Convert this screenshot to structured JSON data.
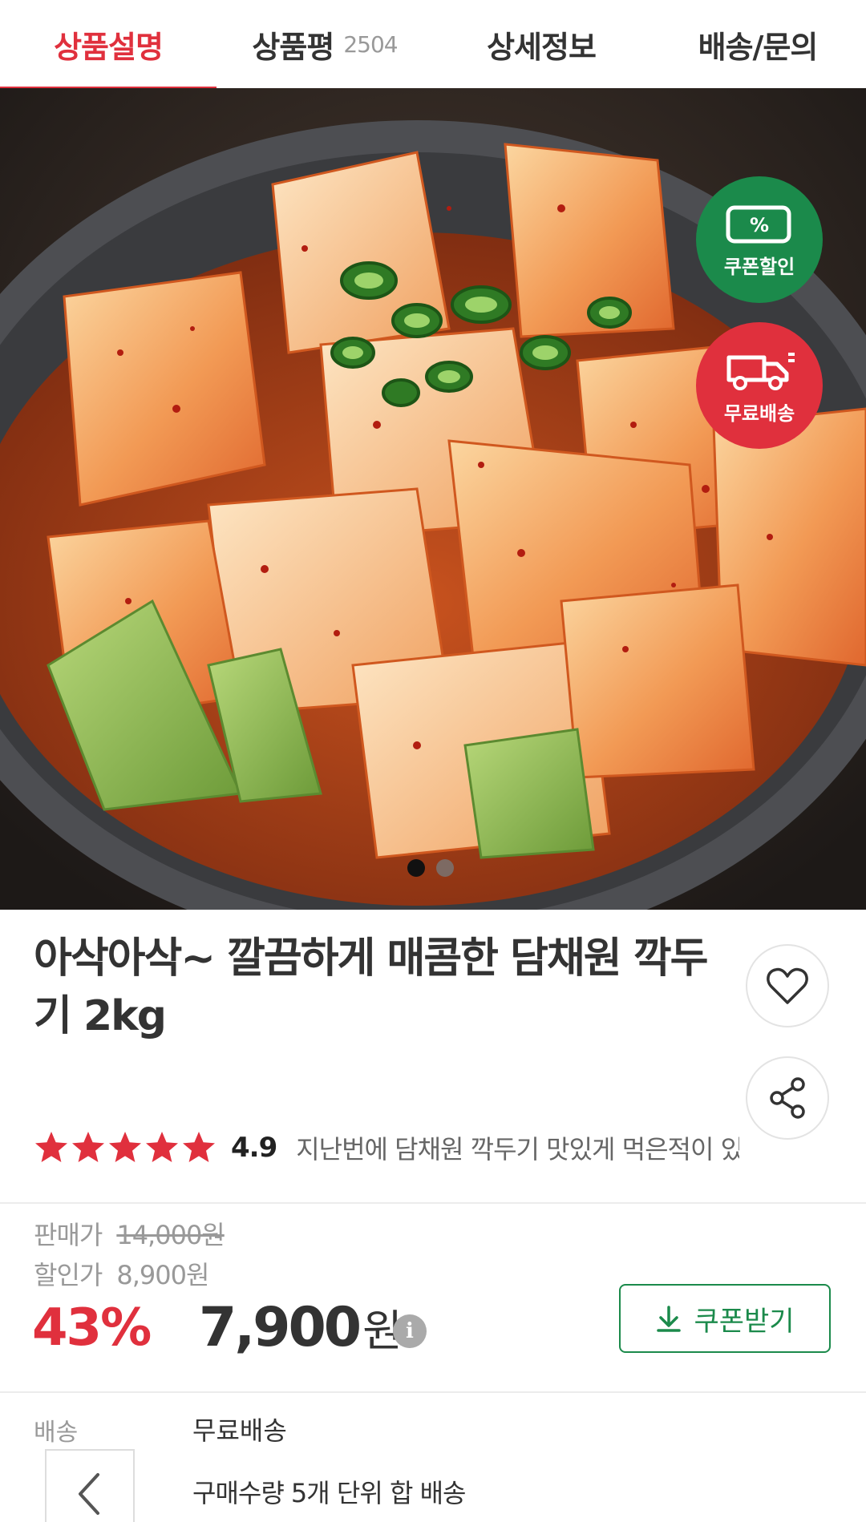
{
  "tabs": [
    {
      "label": "상품설명",
      "active": true
    },
    {
      "label": "상품평",
      "count": "2504"
    },
    {
      "label": "상세정보"
    },
    {
      "label": "배송/문의"
    }
  ],
  "badges": {
    "coupon": "쿠폰할인",
    "delivery": "무료배송"
  },
  "carousel": {
    "total": 2,
    "current": 1
  },
  "product": {
    "title": "아삭아삭~ 깔끔하게 매콤한 담채원 깍두기 2kg",
    "rating_stars": 5,
    "rating": "4.9",
    "review_snippet": "지난번에 담채원 깍두기 맛있게 먹은적이 있어"
  },
  "price": {
    "sale_label": "판매가",
    "sale_value": "14,000원",
    "discount_label": "할인가",
    "discount_value": "8,900원",
    "discount_rate": "43%",
    "final_amount": "7,900",
    "final_unit": "원",
    "coupon_button": "쿠폰받기"
  },
  "shipping": {
    "label": "배송",
    "value": "무료배송",
    "note": "구매수량 5개 단위 합 배송"
  },
  "colors": {
    "accent": "#e0303d",
    "green": "#1b8a4b"
  },
  "icons": [
    "percent-ticket-icon",
    "truck-icon",
    "heart-icon",
    "share-icon",
    "star-icon",
    "info-icon",
    "download-icon",
    "chevron-left-icon"
  ]
}
